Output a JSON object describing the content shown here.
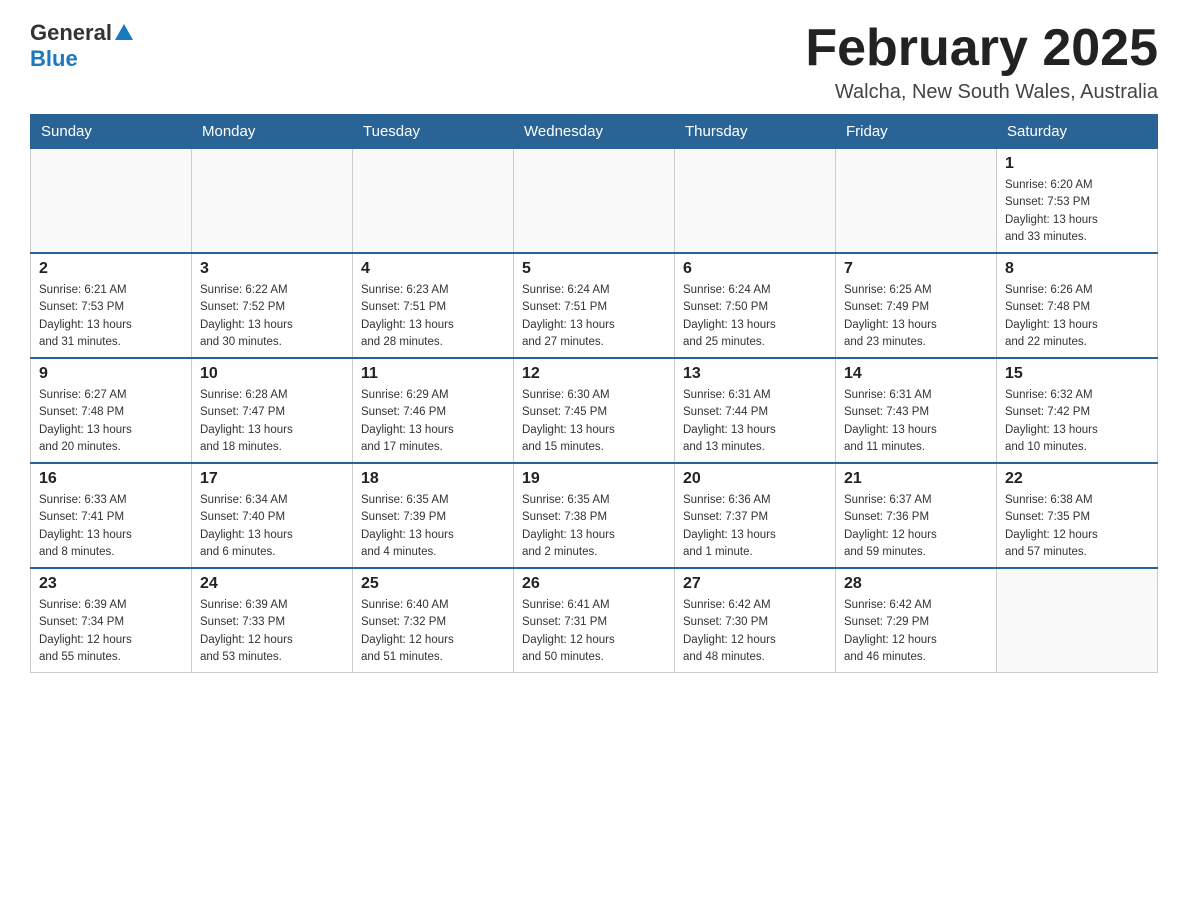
{
  "header": {
    "logo": {
      "general": "General",
      "blue": "Blue"
    },
    "title": "February 2025",
    "subtitle": "Walcha, New South Wales, Australia"
  },
  "days_of_week": [
    "Sunday",
    "Monday",
    "Tuesday",
    "Wednesday",
    "Thursday",
    "Friday",
    "Saturday"
  ],
  "weeks": [
    [
      {
        "day": "",
        "info": ""
      },
      {
        "day": "",
        "info": ""
      },
      {
        "day": "",
        "info": ""
      },
      {
        "day": "",
        "info": ""
      },
      {
        "day": "",
        "info": ""
      },
      {
        "day": "",
        "info": ""
      },
      {
        "day": "1",
        "info": "Sunrise: 6:20 AM\nSunset: 7:53 PM\nDaylight: 13 hours\nand 33 minutes."
      }
    ],
    [
      {
        "day": "2",
        "info": "Sunrise: 6:21 AM\nSunset: 7:53 PM\nDaylight: 13 hours\nand 31 minutes."
      },
      {
        "day": "3",
        "info": "Sunrise: 6:22 AM\nSunset: 7:52 PM\nDaylight: 13 hours\nand 30 minutes."
      },
      {
        "day": "4",
        "info": "Sunrise: 6:23 AM\nSunset: 7:51 PM\nDaylight: 13 hours\nand 28 minutes."
      },
      {
        "day": "5",
        "info": "Sunrise: 6:24 AM\nSunset: 7:51 PM\nDaylight: 13 hours\nand 27 minutes."
      },
      {
        "day": "6",
        "info": "Sunrise: 6:24 AM\nSunset: 7:50 PM\nDaylight: 13 hours\nand 25 minutes."
      },
      {
        "day": "7",
        "info": "Sunrise: 6:25 AM\nSunset: 7:49 PM\nDaylight: 13 hours\nand 23 minutes."
      },
      {
        "day": "8",
        "info": "Sunrise: 6:26 AM\nSunset: 7:48 PM\nDaylight: 13 hours\nand 22 minutes."
      }
    ],
    [
      {
        "day": "9",
        "info": "Sunrise: 6:27 AM\nSunset: 7:48 PM\nDaylight: 13 hours\nand 20 minutes."
      },
      {
        "day": "10",
        "info": "Sunrise: 6:28 AM\nSunset: 7:47 PM\nDaylight: 13 hours\nand 18 minutes."
      },
      {
        "day": "11",
        "info": "Sunrise: 6:29 AM\nSunset: 7:46 PM\nDaylight: 13 hours\nand 17 minutes."
      },
      {
        "day": "12",
        "info": "Sunrise: 6:30 AM\nSunset: 7:45 PM\nDaylight: 13 hours\nand 15 minutes."
      },
      {
        "day": "13",
        "info": "Sunrise: 6:31 AM\nSunset: 7:44 PM\nDaylight: 13 hours\nand 13 minutes."
      },
      {
        "day": "14",
        "info": "Sunrise: 6:31 AM\nSunset: 7:43 PM\nDaylight: 13 hours\nand 11 minutes."
      },
      {
        "day": "15",
        "info": "Sunrise: 6:32 AM\nSunset: 7:42 PM\nDaylight: 13 hours\nand 10 minutes."
      }
    ],
    [
      {
        "day": "16",
        "info": "Sunrise: 6:33 AM\nSunset: 7:41 PM\nDaylight: 13 hours\nand 8 minutes."
      },
      {
        "day": "17",
        "info": "Sunrise: 6:34 AM\nSunset: 7:40 PM\nDaylight: 13 hours\nand 6 minutes."
      },
      {
        "day": "18",
        "info": "Sunrise: 6:35 AM\nSunset: 7:39 PM\nDaylight: 13 hours\nand 4 minutes."
      },
      {
        "day": "19",
        "info": "Sunrise: 6:35 AM\nSunset: 7:38 PM\nDaylight: 13 hours\nand 2 minutes."
      },
      {
        "day": "20",
        "info": "Sunrise: 6:36 AM\nSunset: 7:37 PM\nDaylight: 13 hours\nand 1 minute."
      },
      {
        "day": "21",
        "info": "Sunrise: 6:37 AM\nSunset: 7:36 PM\nDaylight: 12 hours\nand 59 minutes."
      },
      {
        "day": "22",
        "info": "Sunrise: 6:38 AM\nSunset: 7:35 PM\nDaylight: 12 hours\nand 57 minutes."
      }
    ],
    [
      {
        "day": "23",
        "info": "Sunrise: 6:39 AM\nSunset: 7:34 PM\nDaylight: 12 hours\nand 55 minutes."
      },
      {
        "day": "24",
        "info": "Sunrise: 6:39 AM\nSunset: 7:33 PM\nDaylight: 12 hours\nand 53 minutes."
      },
      {
        "day": "25",
        "info": "Sunrise: 6:40 AM\nSunset: 7:32 PM\nDaylight: 12 hours\nand 51 minutes."
      },
      {
        "day": "26",
        "info": "Sunrise: 6:41 AM\nSunset: 7:31 PM\nDaylight: 12 hours\nand 50 minutes."
      },
      {
        "day": "27",
        "info": "Sunrise: 6:42 AM\nSunset: 7:30 PM\nDaylight: 12 hours\nand 48 minutes."
      },
      {
        "day": "28",
        "info": "Sunrise: 6:42 AM\nSunset: 7:29 PM\nDaylight: 12 hours\nand 46 minutes."
      },
      {
        "day": "",
        "info": ""
      }
    ]
  ],
  "accent_color": "#2a6496"
}
